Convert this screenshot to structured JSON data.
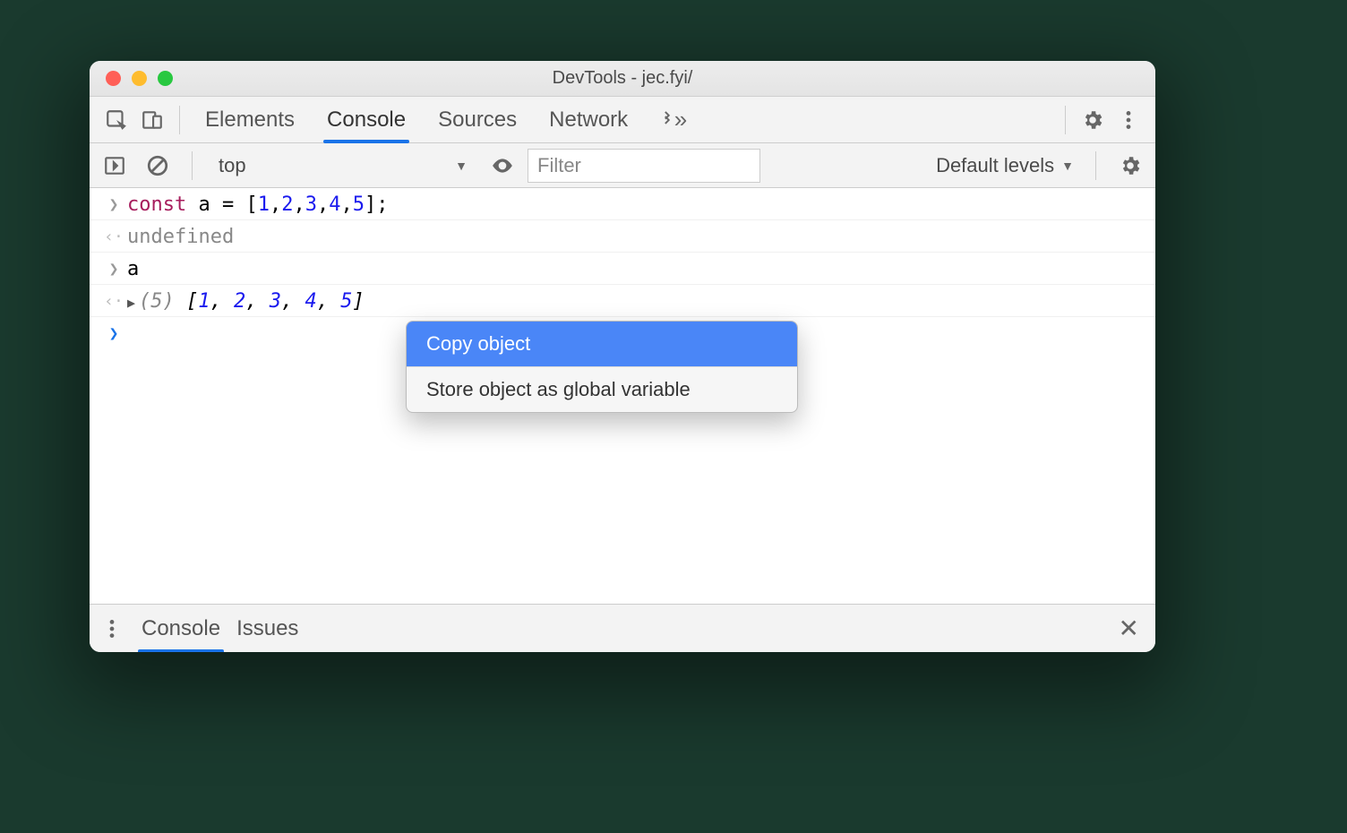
{
  "window": {
    "title": "DevTools - jec.fyi/"
  },
  "tabs": {
    "elements": "Elements",
    "console": "Console",
    "sources": "Sources",
    "network": "Network"
  },
  "filterbar": {
    "context": "top",
    "filter_placeholder": "Filter",
    "levels": "Default levels"
  },
  "console_lines": {
    "line1": {
      "kw": "const",
      "rest": " a = [",
      "n1": "1",
      "n2": "2",
      "n3": "3",
      "n4": "4",
      "n5": "5",
      "close": "];"
    },
    "line2": "undefined",
    "line3": "a",
    "line4": {
      "size": "(5)",
      "open": " [",
      "n1": "1",
      "n2": "2",
      "n3": "3",
      "n4": "4",
      "n5": "5",
      "close": "]",
      "sep": ", "
    }
  },
  "context_menu": {
    "copy": "Copy object",
    "store": "Store object as global variable"
  },
  "drawer": {
    "console": "Console",
    "issues": "Issues"
  }
}
